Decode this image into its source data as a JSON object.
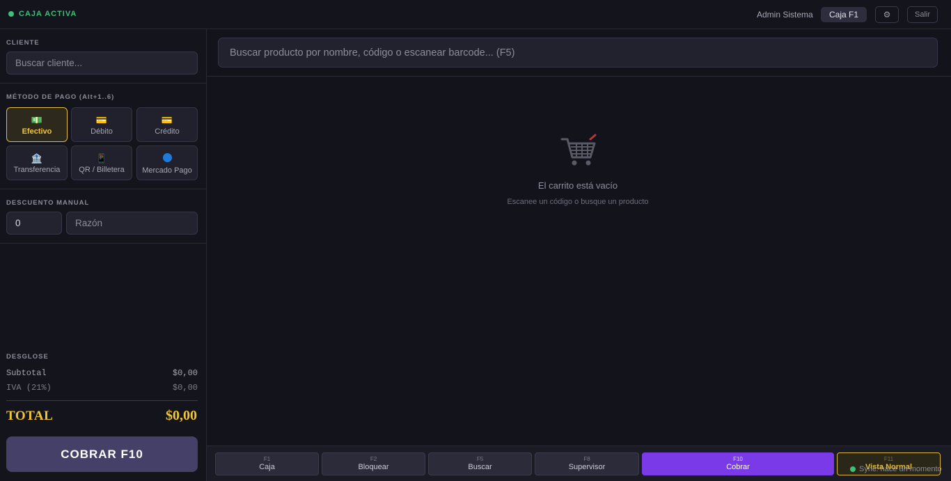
{
  "topbar": {
    "status": "CAJA ACTIVA",
    "user": "Admin Sistema",
    "caja": "Caja F1",
    "settings_icon": "gear-icon",
    "exit": "Salir"
  },
  "left": {
    "cliente_label": "CLIENTE",
    "cliente_placeholder": "Buscar cliente...",
    "pago_label": "MÉTODO DE PAGO (Alt+1..6)",
    "payment_methods": [
      {
        "label": "Efectivo",
        "icon": "cash-icon",
        "active": true
      },
      {
        "label": "Débito",
        "icon": "card-icon"
      },
      {
        "label": "Crédito",
        "icon": "card-icon"
      },
      {
        "label": "Transferencia",
        "icon": "bank-icon"
      },
      {
        "label": "QR / Billetera",
        "icon": "phone-icon"
      },
      {
        "label": "Mercado Pago",
        "icon": "circle-icon"
      }
    ],
    "descuento_label": "DESCUENTO MANUAL",
    "descuento_value": "0",
    "razon_placeholder": "Razón",
    "desglose_label": "DESGLOSE",
    "subtotal_label": "Subtotal",
    "subtotal_value": "$0,00",
    "iva_label": "IVA (21%)",
    "iva_value": "$0,00",
    "total_label": "TOTAL",
    "total_value": "$0,00",
    "cobrar_label": "COBRAR F10"
  },
  "main": {
    "search_placeholder": "Buscar producto por nombre, código o escanear barcode... (F5)",
    "empty_title": "El carrito está vacío",
    "empty_subtitle": "Escanee un código o busque un producto"
  },
  "fkeys": [
    {
      "key": "F1",
      "label": "Caja"
    },
    {
      "key": "F2",
      "label": "Bloquear"
    },
    {
      "key": "F5",
      "label": "Buscar"
    },
    {
      "key": "F8",
      "label": "Supervisor"
    },
    {
      "key": "F10",
      "label": "Cobrar"
    },
    {
      "key": "F11",
      "label": "Vista Normal"
    }
  ],
  "sync_text": "Sync: hace un momento",
  "colors": {
    "accent_gold": "#f0c537",
    "accent_purple": "#7b3ae8",
    "status_green": "#3ec07a",
    "background": "#13131b"
  }
}
